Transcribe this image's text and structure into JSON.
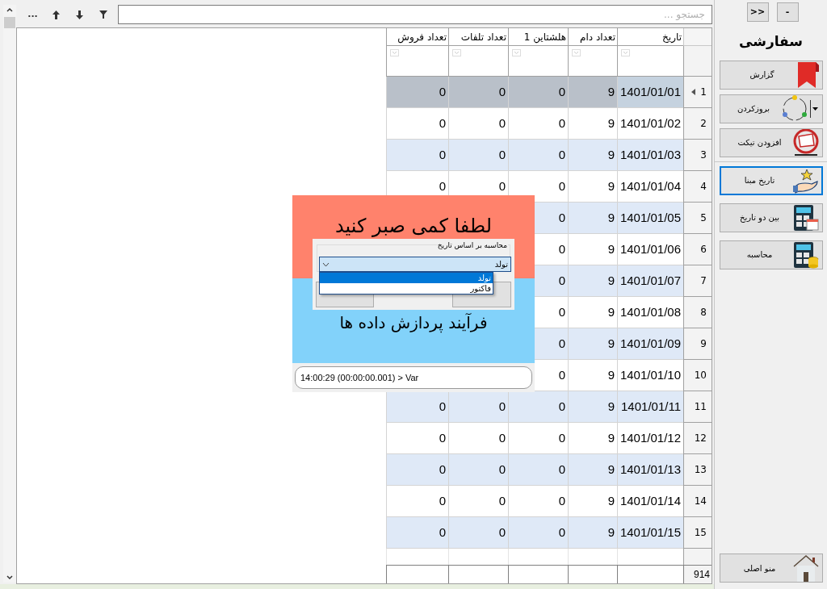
{
  "toolbar": {
    "buttons": [
      {
        "kind": "more",
        "label": "..."
      },
      {
        "kind": "up"
      },
      {
        "kind": "down"
      },
      {
        "kind": "filter"
      }
    ],
    "search": {
      "placeholder": "جستجو ..."
    }
  },
  "grid": {
    "columns": [
      "تاریخ",
      "تعداد دام",
      "هلشتاین 1",
      "تعداد تلفات",
      "تعداد فروش"
    ],
    "rows": [
      {
        "number": "1",
        "selected": true,
        "date": "1401/01/01",
        "herd": "9",
        "holstein": "0",
        "losses": "0",
        "sales": "0"
      },
      {
        "number": "2",
        "selected": false,
        "date": "1401/01/02",
        "herd": "9",
        "holstein": "0",
        "losses": "0",
        "sales": "0"
      },
      {
        "number": "3",
        "selected": false,
        "date": "1401/01/03",
        "herd": "9",
        "holstein": "0",
        "losses": "0",
        "sales": "0"
      },
      {
        "number": "4",
        "selected": false,
        "date": "1401/01/04",
        "herd": "9",
        "holstein": "0",
        "losses": "0",
        "sales": "0"
      },
      {
        "number": "5",
        "selected": false,
        "date": "1401/01/05",
        "herd": "9",
        "holstein": "0"
      },
      {
        "number": "6",
        "selected": false,
        "date": "1401/01/06",
        "herd": "9",
        "holstein": "0"
      },
      {
        "number": "7",
        "selected": false,
        "date": "1401/01/07",
        "herd": "9",
        "holstein": "0"
      },
      {
        "number": "8",
        "selected": false,
        "date": "1401/01/08",
        "herd": "9",
        "holstein": "0"
      },
      {
        "number": "9",
        "selected": false,
        "date": "1401/01/09",
        "herd": "9",
        "holstein": "0"
      },
      {
        "number": "10",
        "selected": false,
        "date": "1401/01/10",
        "herd": "9",
        "holstein": "0"
      },
      {
        "number": "11",
        "selected": false,
        "date": "1401/01/11",
        "herd": "9",
        "holstein": "0",
        "losses": "0",
        "sales": "0"
      },
      {
        "number": "12",
        "selected": false,
        "date": "1401/01/12",
        "herd": "9",
        "holstein": "0",
        "losses": "0",
        "sales": "0"
      },
      {
        "number": "13",
        "selected": false,
        "date": "1401/01/13",
        "herd": "9",
        "holstein": "0",
        "losses": "0",
        "sales": "0"
      },
      {
        "number": "14",
        "selected": false,
        "date": "1401/01/14",
        "herd": "9",
        "holstein": "0",
        "losses": "0",
        "sales": "0"
      },
      {
        "number": "15",
        "selected": false,
        "date": "1401/01/15",
        "herd": "9",
        "holstein": "0",
        "losses": "0",
        "sales": "0"
      }
    ],
    "footer": {
      "count": "914"
    }
  },
  "progress": {
    "wait_text": "لطفا کمی صبر کنید",
    "process_text": "فرآیند پردازش داده ها",
    "log": "14:00:29 (00:00:00.001) > Var",
    "dialog": {
      "group_label": "محاسبه بر اساس تاریخ",
      "combo": {
        "value": "تولد",
        "expanded": true,
        "options": [
          {
            "label": "تولد",
            "selected": true
          },
          {
            "label": "فاکتور",
            "selected": false
          }
        ]
      }
    }
  },
  "sidebar": {
    "top_buttons": [
      "-",
      ">>"
    ],
    "title": "سفارشی",
    "groups": [
      [
        {
          "kind": "bookmark",
          "label": "گزارش",
          "selected": false,
          "has_menu": false
        },
        {
          "kind": "cycle",
          "label": "بروزکردن",
          "selected": false,
          "has_menu": true
        },
        {
          "kind": "ticket",
          "label": "افزودن تیکت",
          "selected": false,
          "has_menu": false
        }
      ],
      [
        {
          "kind": "hand-star",
          "label": "تاریخ مبنا",
          "selected": true,
          "has_menu": false
        },
        {
          "kind": "calc-calendar",
          "label": "بین دو تاریخ",
          "selected": false,
          "has_menu": false
        },
        {
          "kind": "calc-coins",
          "label": "محاسبه",
          "selected": false,
          "has_menu": false
        }
      ]
    ],
    "footer_button": {
      "kind": "house",
      "label": "منو اصلی",
      "selected": false,
      "has_menu": false
    }
  }
}
